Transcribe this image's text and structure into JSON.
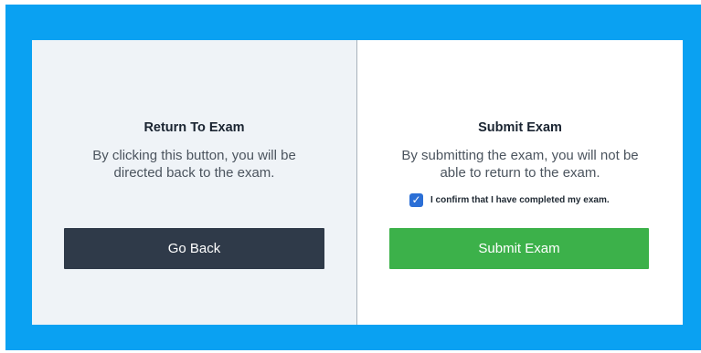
{
  "return_panel": {
    "title": "Return To Exam",
    "description_line1": "By clicking this button, you will be",
    "description_line2": "directed back to the exam.",
    "button_label": "Go Back"
  },
  "submit_panel": {
    "title": "Submit Exam",
    "description_line1": "By submitting the exam, you will not be",
    "description_line2": "able to return to the exam.",
    "confirm_label": "I confirm that I have completed my exam.",
    "confirm_checked": true,
    "button_label": "Submit Exam"
  },
  "colors": {
    "frame": "#0aa1f2",
    "go_back_button": "#2f3a49",
    "submit_button": "#3cb14a",
    "checkbox": "#2b6fd6"
  }
}
